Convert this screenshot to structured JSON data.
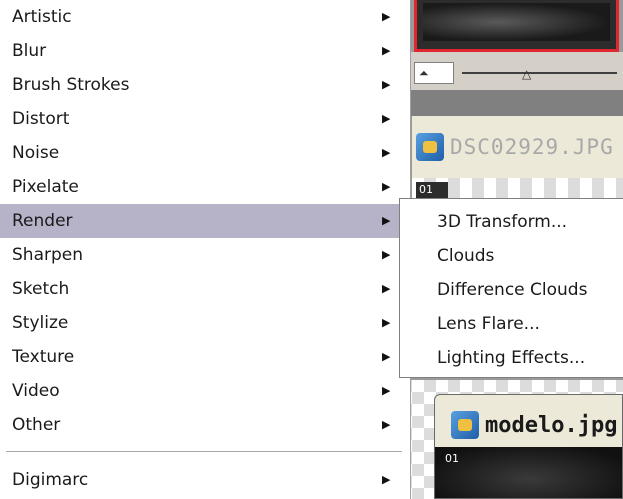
{
  "background": {
    "document1_title": "DSC02929.JPG",
    "document1_tag": "01",
    "document2_title": "modelo.jpg",
    "document2_tag": "01"
  },
  "menu": {
    "items": [
      {
        "label": "Artistic",
        "has_submenu": true
      },
      {
        "label": "Blur",
        "has_submenu": true
      },
      {
        "label": "Brush Strokes",
        "has_submenu": true
      },
      {
        "label": "Distort",
        "has_submenu": true
      },
      {
        "label": "Noise",
        "has_submenu": true
      },
      {
        "label": "Pixelate",
        "has_submenu": true
      },
      {
        "label": "Render",
        "has_submenu": true,
        "active": true
      },
      {
        "label": "Sharpen",
        "has_submenu": true
      },
      {
        "label": "Sketch",
        "has_submenu": true
      },
      {
        "label": "Stylize",
        "has_submenu": true
      },
      {
        "label": "Texture",
        "has_submenu": true
      },
      {
        "label": "Video",
        "has_submenu": true
      },
      {
        "label": "Other",
        "has_submenu": true
      }
    ],
    "footer_item": {
      "label": "Digimarc",
      "has_submenu": true
    },
    "arrow_glyph": "▶",
    "highlight_color": "#b6b2c8"
  },
  "submenu": {
    "parent": "Render",
    "items": [
      {
        "label": "3D Transform..."
      },
      {
        "label": "Clouds"
      },
      {
        "label": "Difference Clouds"
      },
      {
        "label": "Lens Flare..."
      },
      {
        "label": "Lighting Effects..."
      }
    ]
  },
  "icons": {
    "document_icon": "image-document-icon",
    "zoom_icon": "zoom-mountain-icon",
    "slider_thumb": "slider-triangle-icon"
  }
}
